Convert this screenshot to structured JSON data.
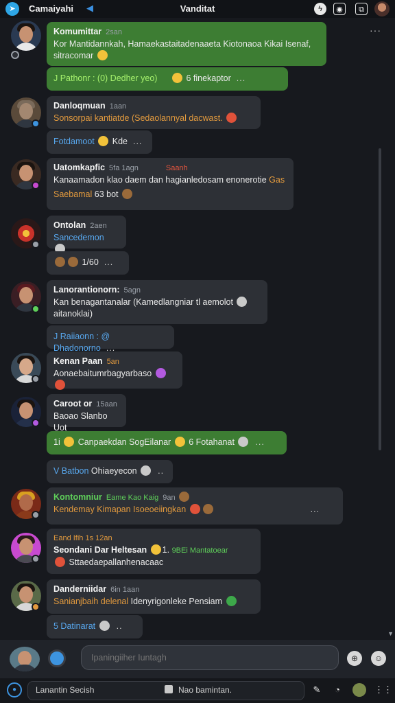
{
  "topbar": {
    "app_name": "Camaiyahi",
    "title": "Vanditat",
    "icons": [
      "telegram-icon",
      "lightning-icon",
      "record-icon",
      "expand-icon",
      "profile-avatar"
    ]
  },
  "colors": {
    "background": "#17191e",
    "bubble_dark": "#2d3036",
    "bubble_green": "#3d7d33",
    "accent_blue": "#3d94e0",
    "accent_orange": "#e29a3e"
  },
  "messages": [
    {
      "name": "Komumittar",
      "time": "2san",
      "text": "Kor Mantidannkah, Hamaekastaitadenaaeta Kiotonaoa Kikai Isenaf, sitracomar",
      "green": true
    },
    {
      "reply": "J Pathonr : (0) Dedher yeo)",
      "extra": "6 finekaptor",
      "green": true
    },
    {
      "name": "Danloqmuan",
      "time": "1aan",
      "text": "Sonsorpai kantiatde (Sedaolannyal dacwast."
    },
    {
      "reply": "Fotdamoot",
      "extra": "Kde"
    },
    {
      "name": "Uatomkapfic",
      "time": "5fa 1agn",
      "tag": "Saanh",
      "text": "Kanaamadon klao daem dan hagianledosam enonerotie",
      "tag2": "Gas",
      "sub": "Saebamal",
      "sub2": "63 bot"
    },
    {
      "name": "Ontolan",
      "time": "2aen",
      "sub": "Sancedemon"
    },
    {
      "reply": "1/60"
    },
    {
      "name": "Lanorantionorn:",
      "time": "5agn",
      "text": "Kan benagantanalar (Kamedlangniar tl aemolot",
      "sub": "aitanoklai)"
    },
    {
      "reply": "J Raiiaonn : @ Dhadonorno"
    },
    {
      "name": "Kenan Paan",
      "time": "5an",
      "sub": "Aonaebaitumrbagyarbaso"
    },
    {
      "name": "Caroot or",
      "time": "15aan",
      "sub": "Baoao Slanbo Uot"
    },
    {
      "reply": "Canpaekdan SogEilanar",
      "extra": "6 Fotahanat",
      "lead": "1i",
      "green": true
    },
    {
      "reply": "V Batbon",
      "extra": "Ohiaeyecon"
    },
    {
      "name": "Kontomniur",
      "time": "Eame Kao Kaig",
      "tag": "9an",
      "sub": "Kendemay Kimapan Isoeoeiingkan"
    },
    {
      "name": "Seondani Dar Heltesan",
      "time": "Eand Ifih 1s 12an",
      "tag": "1.",
      "tag2": "9BEi Mantatoear",
      "sub": "Sttaedaepallanhenacaac"
    },
    {
      "name": "Danderniidar",
      "time": "6in 1aan",
      "sub": "Sanianjbaih delenal",
      "sub2": "Idenyrigonleke Pensiam"
    },
    {
      "reply": "5 Datinarat"
    }
  ],
  "composer": {
    "placeholder": "Ipaningiiher Iuntagh"
  },
  "bottombar": {
    "search_text": "Lanantin Secish",
    "doc_text": "Nao bamintan."
  }
}
